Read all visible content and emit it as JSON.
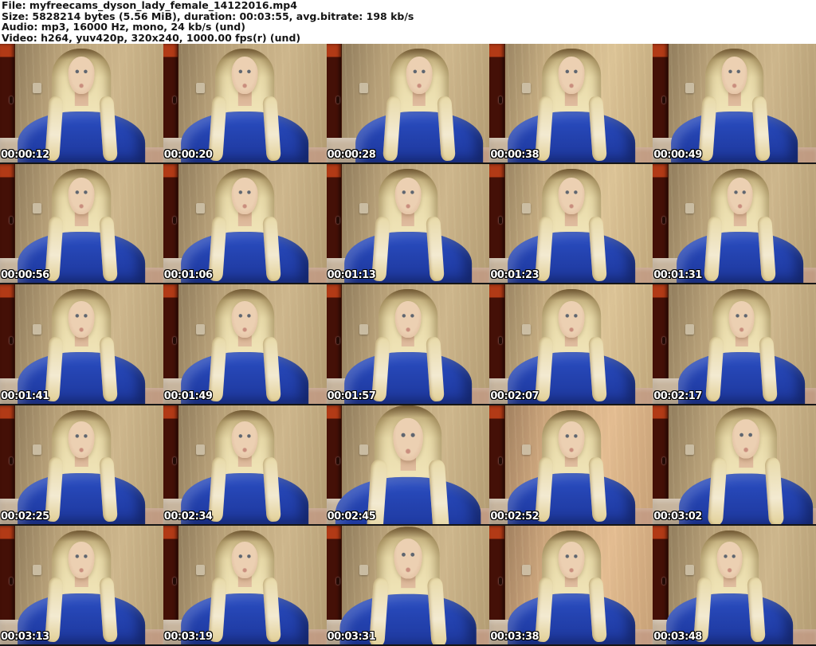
{
  "header": {
    "lines": [
      "File: myfreecams_dyson_lady_female_14122016.mp4",
      "Size: 5828214 bytes (5.56 MiB), duration: 00:03:55, avg.bitrate: 198 kb/s",
      "Audio: mp3, 16000 Hz, mono, 24 kb/s (und)",
      "Video: h264, yuv420p, 320x240, 1000.00 fps(r) (und)"
    ]
  },
  "thumbnails": [
    {
      "timestamp": "00:00:12"
    },
    {
      "timestamp": "00:00:20"
    },
    {
      "timestamp": "00:00:28"
    },
    {
      "timestamp": "00:00:38"
    },
    {
      "timestamp": "00:00:49"
    },
    {
      "timestamp": "00:00:56"
    },
    {
      "timestamp": "00:01:06"
    },
    {
      "timestamp": "00:01:13"
    },
    {
      "timestamp": "00:01:23"
    },
    {
      "timestamp": "00:01:31"
    },
    {
      "timestamp": "00:01:41"
    },
    {
      "timestamp": "00:01:49"
    },
    {
      "timestamp": "00:01:57"
    },
    {
      "timestamp": "00:02:07"
    },
    {
      "timestamp": "00:02:17"
    },
    {
      "timestamp": "00:02:25"
    },
    {
      "timestamp": "00:02:34"
    },
    {
      "timestamp": "00:02:45"
    },
    {
      "timestamp": "00:02:52"
    },
    {
      "timestamp": "00:03:02"
    },
    {
      "timestamp": "00:03:13"
    },
    {
      "timestamp": "00:03:19"
    },
    {
      "timestamp": "00:03:31"
    },
    {
      "timestamp": "00:03:38"
    },
    {
      "timestamp": "00:03:48"
    }
  ],
  "colors": {
    "header_bg": "#ffffff",
    "header_text": "#141414",
    "timestamp_text": "#ffffff",
    "door": "#441007",
    "door_accent": "#b23a16",
    "wall": "#b7a078",
    "wall_light": "#cdb68c",
    "couch": "#c7b59e",
    "hair": "#e8daa9",
    "hair_root": "#6f5736",
    "skin": "#e0bd9f",
    "shirt": "#2b4fc4",
    "shirt_dark": "#1d379c"
  }
}
